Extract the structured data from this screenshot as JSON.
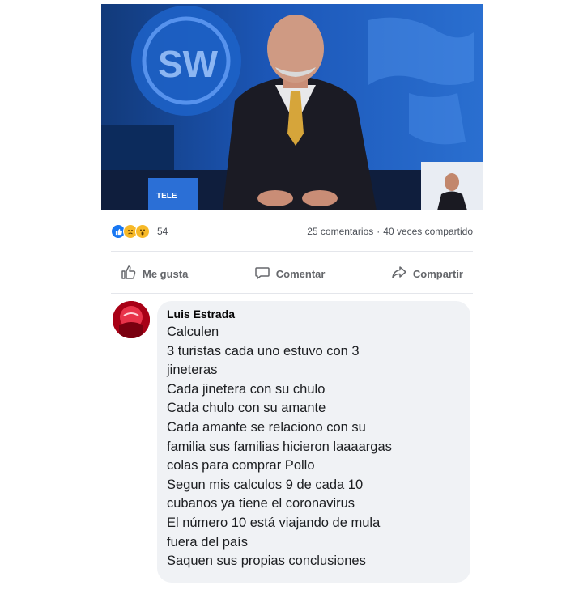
{
  "post": {
    "media": {
      "logo_text": "SW",
      "ticker_text": "TELE"
    },
    "stats": {
      "reaction_icons": [
        "like-icon",
        "sad-icon",
        "wow-icon"
      ],
      "reaction_count": "54",
      "comments": "25 comentarios",
      "separator": "·",
      "shares": "40 veces compartido"
    },
    "actions": {
      "like": "Me gusta",
      "comment": "Comentar",
      "share": "Compartir"
    },
    "comment": {
      "author": "Luis Estrada",
      "lines": [
        "Calculen",
        "3 turistas cada uno estuvo con 3",
        "jineteras",
        "Cada jinetera con su chulo",
        "Cada chulo con su amante",
        "Cada amante se relaciono con su",
        "familia sus familias hicieron laaaargas",
        "colas para comprar Pollo",
        "Segun mis calculos 9 de cada 10",
        "cubanos ya tiene el coronavirus",
        "El número 10 está viajando de mula",
        "fuera del país",
        "Saquen sus propias conclusiones"
      ]
    }
  },
  "colors": {
    "accent": "#1877f2",
    "bubble": "#f0f2f5",
    "muted": "#65676b"
  }
}
